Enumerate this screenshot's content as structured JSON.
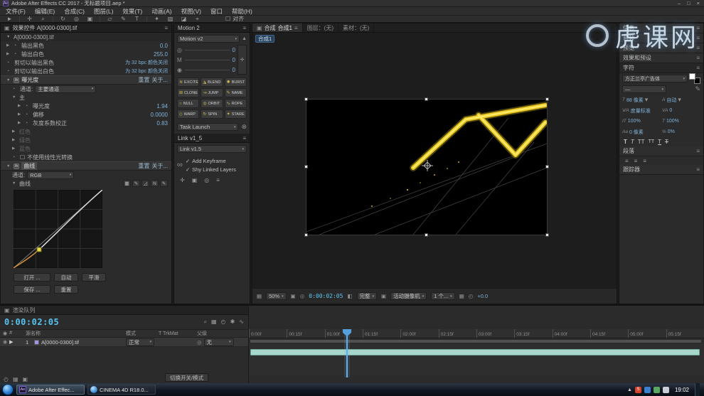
{
  "icons": {
    "menu": "≡",
    "twirl_open": "▼",
    "twirl_right": "▶",
    "dropdown": "▾",
    "stopwatch": "◔",
    "fx": "fx",
    "checkbox": "☐",
    "check": "✓",
    "eye": "◉",
    "chain": "∞",
    "trash": "⊗",
    "search": "⌕",
    "camera": "◧",
    "grid": "▦",
    "pencil": "✎",
    "corner": "◿",
    "ntool": "Ν",
    "clock": "◴",
    "star": "✱",
    "wave": "∿",
    "plus": "✚",
    "anchor": "✛",
    "pickwhip": "◎",
    "up": "▲",
    "lockbox": "▣"
  },
  "titlebar": {
    "app_icon": "Ae",
    "title": "Adobe After Effects CC 2017 - 无标题项目.aep *",
    "min": "–",
    "max": "□",
    "close": "×"
  },
  "menubar": {
    "items": [
      "文件(F)",
      "编辑(E)",
      "合成(C)",
      "图层(L)",
      "效果(T)",
      "动画(A)",
      "视图(V)",
      "窗口",
      "帮助(H)"
    ]
  },
  "toolbar": {
    "tools": [
      "►",
      "✛",
      "⌕",
      "↻",
      "◎",
      "▣",
      "▱",
      "✎",
      "T",
      "✦",
      "▨",
      "◪",
      "⌖"
    ],
    "snap_label": "对齐"
  },
  "watermark": {
    "text": "虎课网"
  },
  "effect_controls": {
    "tab": "效果控件 A[0000-0300].tif",
    "source_row": "A[0000-0300].tif",
    "levels_rows": [
      {
        "label": "输出黑色",
        "value": "0.0"
      },
      {
        "label": "输出白色",
        "value": "255.0"
      },
      {
        "label": "剪切以输出黑色",
        "value": "为 32 bpc 颜色关闭"
      },
      {
        "label": "剪切以输出白色",
        "value": "为 32 bpc 颜色关闭"
      }
    ],
    "exposure": {
      "name": "曝光度",
      "reset": "重置",
      "about": "关于...",
      "channel_label": "通道:",
      "channel_value": "主要通道",
      "group": "主",
      "params": [
        {
          "label": "曝光度",
          "value": "1.94"
        },
        {
          "label": "偏移",
          "value": "0.0000"
        },
        {
          "label": "灰度系数校正",
          "value": "0.83"
        }
      ],
      "disabled_rows": [
        "红色",
        "绿色",
        "蓝色"
      ],
      "checkbox_label": "不使用线性光转换"
    },
    "curves": {
      "name": "曲线",
      "reset": "重置",
      "about": "关于...",
      "channel_label": "通道:",
      "channel_value": "RGB",
      "group": "曲线",
      "btn_open": "打开 ...",
      "btn_auto": "自动",
      "btn_smooth": "平滑",
      "btn_save": "保存 ...",
      "btn_reset": "重置"
    }
  },
  "motion": {
    "title": "Motion 2",
    "preset": "Motion v2",
    "values": [
      "0",
      "0",
      "0"
    ],
    "buttons": [
      {
        "icon": "≋",
        "label": "EXCITE"
      },
      {
        "icon": "◮",
        "label": "BLEND"
      },
      {
        "icon": "✹",
        "label": "BURST"
      },
      {
        "icon": "⊞",
        "label": "CLONE"
      },
      {
        "icon": "↝",
        "label": "JUMP"
      },
      {
        "icon": "✎",
        "label": "NAME"
      },
      {
        "icon": "○",
        "label": "NULL"
      },
      {
        "icon": "◎",
        "label": "ORBIT"
      },
      {
        "icon": "∿",
        "label": "ROPE"
      },
      {
        "icon": "◇",
        "label": "WARP"
      },
      {
        "icon": "↻",
        "label": "SPIN"
      },
      {
        "icon": "✦",
        "label": "STARE"
      }
    ],
    "task_launch": "Task Launch",
    "link_title": "Link v1_5",
    "link_preset": "Link v1.5",
    "opt_add_keyframe": "Add Keyframe",
    "opt_shy": "Shy Linked Layers"
  },
  "viewer": {
    "tab_comp": "合成",
    "comp_name": "合成1",
    "tab_layer": "图层：(无)",
    "tab_footage": "素材：(无)",
    "badge": "合成1",
    "status": {
      "zoom": "50%",
      "timecode": "0:00:02:05",
      "res": "完整",
      "camera": "活动摄像机",
      "views": "1 个...",
      "exposure": "+0.0"
    }
  },
  "rightbar": {
    "panels": [
      "信息",
      "音频",
      "预览",
      "效果和预设"
    ],
    "character": {
      "title": "字符",
      "font": "方正兰亭广告体",
      "style": "—",
      "size_token": "T",
      "size": "88 像素",
      "leading_token": "A",
      "leading": "自动",
      "kerning_token": "V∕A",
      "kerning": "度量标准",
      "tracking_token": "VA",
      "tracking": "0",
      "vscale_token": "IT",
      "vscale": "100%",
      "hscale_token": "T",
      "hscale": "100%",
      "baseline_token": "Aa",
      "baseline": "0 像素",
      "tsume_token": "%",
      "tsume": "0%",
      "faux": [
        "T",
        "T",
        "TT",
        "TT",
        "T",
        "T"
      ]
    },
    "paragraph": "段落",
    "tracker": "跟踪器"
  },
  "timeline": {
    "tab": "渲染队列",
    "timecode": "0:00:02:05",
    "col_av": "◉",
    "col_num": "#",
    "col_source": "源名称",
    "col_mode": "模式",
    "col_trkmat": "T TrkMat",
    "col_parent": "父级",
    "layer": {
      "index": "1",
      "name": "A[0000-0300].tif",
      "mode": "正常",
      "parent": "无"
    },
    "ruler": [
      "0:00f",
      "00:15f",
      "01:00f",
      "01:15f",
      "02:00f",
      "02:15f",
      "03:00f",
      "03:15f",
      "04:00f",
      "04:15f",
      "05:00f",
      "05:15f"
    ],
    "footer_button": "切换开关/模式"
  },
  "taskbar": {
    "app1": "Adobe After Effec...",
    "app2": "CINEMA 4D R18.0...",
    "sogou": "S",
    "time": "19:02"
  }
}
